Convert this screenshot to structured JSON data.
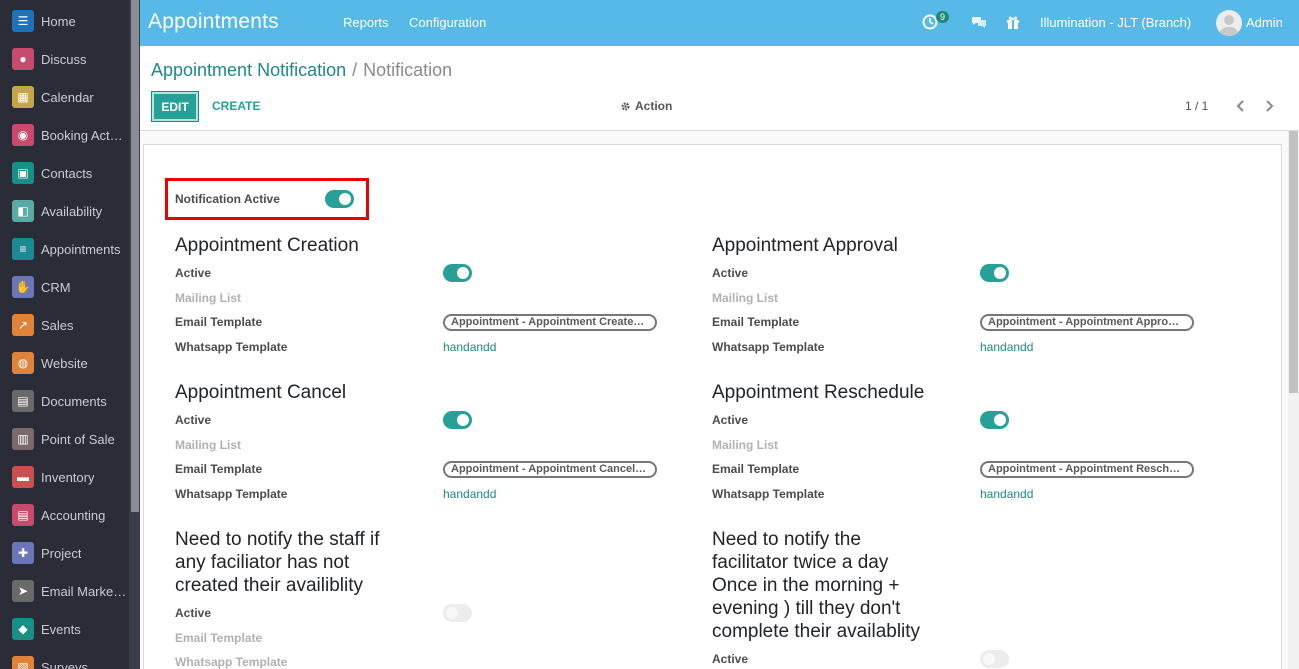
{
  "sidebar": {
    "items": [
      {
        "label": "Home",
        "icon": "home-icon",
        "color": "#1f72b8"
      },
      {
        "label": "Discuss",
        "icon": "chat-icon",
        "color": "#c84b6e"
      },
      {
        "label": "Calendar",
        "icon": "calendar-icon",
        "color": "#c4a74a"
      },
      {
        "label": "Booking Act…",
        "icon": "booking-icon",
        "color": "#c84b6e"
      },
      {
        "label": "Contacts",
        "icon": "contacts-icon",
        "color": "#1a8f86"
      },
      {
        "label": "Availability",
        "icon": "availability-icon",
        "color": "#5aa9a4"
      },
      {
        "label": "Appointments",
        "icon": "appointments-icon",
        "color": "#1f8a96"
      },
      {
        "label": "CRM",
        "icon": "handshake-icon",
        "color": "#6a76b8"
      },
      {
        "label": "Sales",
        "icon": "sales-icon",
        "color": "#e0833a"
      },
      {
        "label": "Website",
        "icon": "globe-icon",
        "color": "#e0833a"
      },
      {
        "label": "Documents",
        "icon": "documents-icon",
        "color": "#6a6a6a"
      },
      {
        "label": "Point of Sale",
        "icon": "store-icon",
        "color": "#7a6a6a"
      },
      {
        "label": "Inventory",
        "icon": "box-icon",
        "color": "#c8504e"
      },
      {
        "label": "Accounting",
        "icon": "accounting-icon",
        "color": "#c84b6e"
      },
      {
        "label": "Project",
        "icon": "puzzle-icon",
        "color": "#6a76b8"
      },
      {
        "label": "Email Marke…",
        "icon": "email-icon",
        "color": "#6a6a6a"
      },
      {
        "label": "Events",
        "icon": "ticket-icon",
        "color": "#1a8f86"
      },
      {
        "label": "Surveys",
        "icon": "survey-icon",
        "color": "#e0833a"
      }
    ]
  },
  "topbar": {
    "app_title": "Appointments",
    "menu_reports": "Reports",
    "menu_configuration": "Configuration",
    "activity_count": "9",
    "company": "Illumination - JLT (Branch)",
    "user": "Admin"
  },
  "control_panel": {
    "breadcrumb_parent": "Appointment Notification",
    "breadcrumb_sep": "/",
    "breadcrumb_current": "Notification",
    "edit_label": "EDIT",
    "create_label": "CREATE",
    "action_label": "Action",
    "pager": "1 / 1"
  },
  "form": {
    "notification_active_label": "Notification Active",
    "labels": {
      "active": "Active",
      "mailing_list": "Mailing List",
      "email_template": "Email Template",
      "whatsapp_template": "Whatsapp Template"
    },
    "sections": {
      "creation": {
        "title": "Appointment Creation",
        "email_template": "Appointment - Appointment Create…",
        "whatsapp": "handandd"
      },
      "approval": {
        "title": "Appointment Approval",
        "email_template": "Appointment - Appointment Appro…",
        "whatsapp": "handandd"
      },
      "cancel": {
        "title": "Appointment Cancel",
        "email_template": "Appointment - Appointment Cancel…",
        "whatsapp": "handandd"
      },
      "reschedule": {
        "title": "Appointment Reschedule",
        "email_template": "Appointment - Appointment Resch…",
        "whatsapp": "handandd"
      },
      "staff_notify": {
        "title_lines": [
          "Need to notify the staff if",
          "any faciliator has not",
          "created their availiblity"
        ]
      },
      "facilitator_notify": {
        "title_lines": [
          "Need to notify the",
          "facilitator twice a day",
          "Once in the morning +",
          "evening ) till they don't",
          "complete their availablity"
        ]
      }
    }
  }
}
